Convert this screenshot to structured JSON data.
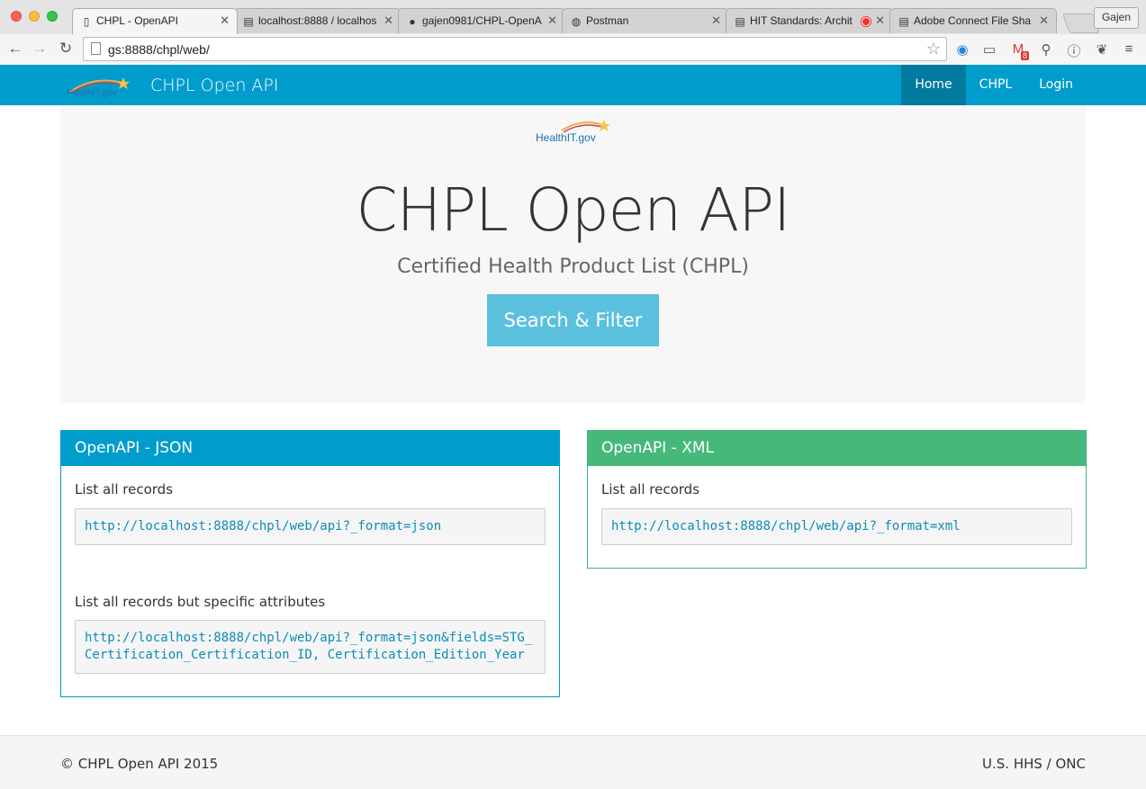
{
  "browser": {
    "tabs": [
      {
        "title": "CHPL - OpenAPI",
        "icon": "page-icon",
        "active": true
      },
      {
        "title": "localhost:8888 / localhos",
        "icon": "phpmyadmin-icon"
      },
      {
        "title": "gajen0981/CHPL-OpenA",
        "icon": "github-icon"
      },
      {
        "title": "Postman",
        "icon": "globe-icon"
      },
      {
        "title": "HIT Standards: Archit",
        "icon": "site-icon",
        "recording": true
      },
      {
        "title": "Adobe Connect File Sha",
        "icon": "site-icon"
      }
    ],
    "profile": "Gajen",
    "url": "gs:8888/chpl/web/",
    "badge_count": "8"
  },
  "navbar": {
    "brand": "CHPL Open API",
    "logo_text": "HealthIT.gov",
    "links": [
      {
        "label": "Home",
        "active": true
      },
      {
        "label": "CHPL"
      },
      {
        "label": "Login"
      }
    ]
  },
  "hero": {
    "logo_text": "HealthIT.gov",
    "title": "CHPL Open API",
    "subtitle": "Certified Health Product List (CHPL)",
    "button": "Search & Filter"
  },
  "panels": {
    "json": {
      "title": "OpenAPI - JSON",
      "items": [
        {
          "label": "List all records",
          "url": "http://localhost:8888/chpl/web/api?_format=json"
        },
        {
          "label": "List all records but specific attributes",
          "url": "http://localhost:8888/chpl/web/api?_format=json&fields=STG_\nCertification_Certification_ID, Certification_Edition_Year"
        }
      ]
    },
    "xml": {
      "title": "OpenAPI - XML",
      "items": [
        {
          "label": "List all records",
          "url": "http://localhost:8888/chpl/web/api?_format=xml"
        }
      ]
    }
  },
  "footer": {
    "left": "© CHPL Open API 2015",
    "right": "U.S. HHS / ONC"
  },
  "colors": {
    "navbar": "#009ccc",
    "nav_active": "#007a9f",
    "json_panel": "#009ccc",
    "xml_panel": "#46b97a",
    "button": "#5bc0de"
  }
}
